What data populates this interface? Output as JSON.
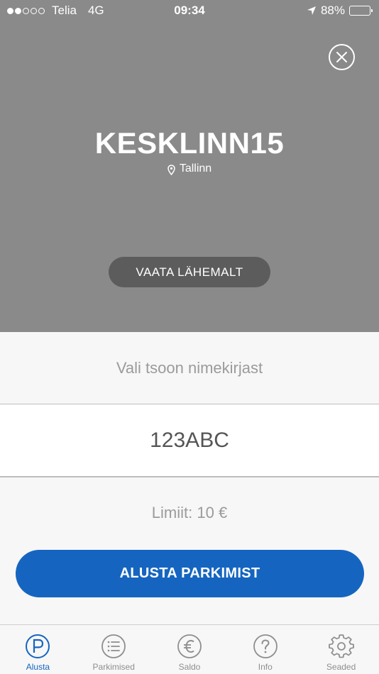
{
  "status_bar": {
    "carrier": "Telia",
    "network": "4G",
    "time": "09:34",
    "battery": "88%",
    "battery_level": 0.88
  },
  "zone": {
    "name": "KESKLINN15",
    "city": "Tallinn"
  },
  "header": {
    "view_button_label": "VAATA LÄHEMALT"
  },
  "form": {
    "zone_placeholder": "Vali tsoon nimekirjast",
    "plate": "123ABC",
    "limit": "Limiit: 10 €",
    "start_button_label": "ALUSTA PARKIMIST"
  },
  "tabs": [
    {
      "label": "Alusta",
      "icon": "parking-icon",
      "active": true
    },
    {
      "label": "Parkimised",
      "icon": "list-icon",
      "active": false
    },
    {
      "label": "Saldo",
      "icon": "euro-icon",
      "active": false
    },
    {
      "label": "Info",
      "icon": "question-icon",
      "active": false
    },
    {
      "label": "Seaded",
      "icon": "gear-icon",
      "active": false
    }
  ],
  "colors": {
    "accent": "#1565c0",
    "header_bg": "#8a8a8a",
    "button_dark": "#5c5c5c"
  }
}
